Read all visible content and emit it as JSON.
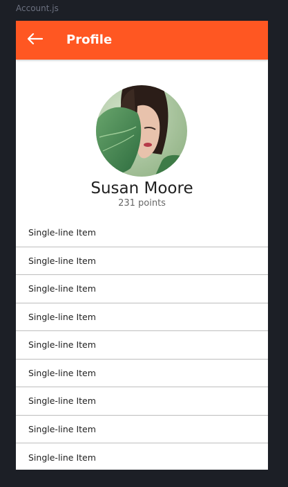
{
  "file_label": "Account.js",
  "appbar": {
    "title": "Profile",
    "back_icon": "arrow-left-icon",
    "color": "#ff5722"
  },
  "profile": {
    "name": "Susan Moore",
    "points": "231 points",
    "avatar": "avatar-photo"
  },
  "list": {
    "items": [
      {
        "label": "Single-line Item"
      },
      {
        "label": "Single-line Item"
      },
      {
        "label": "Single-line Item"
      },
      {
        "label": "Single-line Item"
      },
      {
        "label": "Single-line Item"
      },
      {
        "label": "Single-line Item"
      },
      {
        "label": "Single-line Item"
      },
      {
        "label": "Single-line Item"
      },
      {
        "label": "Single-line Item"
      }
    ]
  }
}
